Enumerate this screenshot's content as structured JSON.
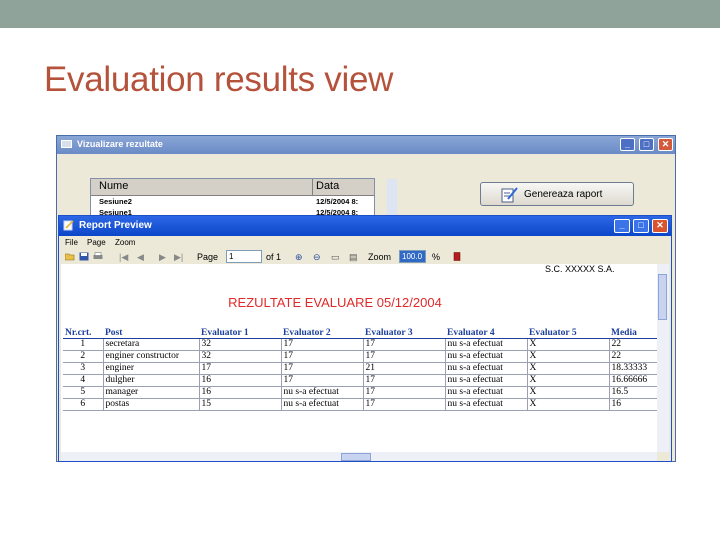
{
  "slide": {
    "title": "Evaluation results view"
  },
  "outer_window": {
    "title": "Vizualizare rezultate",
    "controls": {
      "minimize": "_",
      "maximize": "□",
      "close": "✕"
    }
  },
  "sessions": {
    "headers": [
      "Nume",
      "Data"
    ],
    "rows": [
      [
        "Sesiune2",
        "12/5/2004 8:"
      ],
      [
        "Sesiune1",
        "12/5/2004 8:"
      ]
    ]
  },
  "generate_button": {
    "label": "Genereaza raport",
    "icon": "report-pencil-icon"
  },
  "report_window": {
    "title": "Report Preview",
    "controls": {
      "minimize": "_",
      "maximize": "□",
      "close": "✕"
    },
    "menu": [
      "File",
      "Page",
      "Zoom"
    ],
    "toolbar": {
      "page_label": "Page",
      "page_value": "1",
      "of_label": "of 1",
      "zoom_label": "Zoom",
      "zoom_value": "100.0",
      "percent": "%"
    }
  },
  "report": {
    "company": "S.C. XXXXX S.A.",
    "heading": "REZULTATE EVALUARE 05/12/2004",
    "columns": [
      "Nr.crt.",
      "Post",
      "Evaluator 1",
      "Evaluator 2",
      "Evaluator 3",
      "Evaluator 4",
      "Evaluator 5",
      "Media"
    ],
    "rows": [
      [
        "1",
        "secretara",
        "32",
        "17",
        "17",
        "nu s-a efectuat",
        "X",
        "22"
      ],
      [
        "2",
        "enginer constructor",
        "32",
        "17",
        "17",
        "nu s-a efectuat",
        "X",
        "22"
      ],
      [
        "3",
        "enginer",
        "17",
        "17",
        "21",
        "nu s-a efectuat",
        "X",
        "18.33333"
      ],
      [
        "4",
        "dulgher",
        "16",
        "17",
        "17",
        "nu s-a efectuat",
        "X",
        "16.66666"
      ],
      [
        "5",
        "manager",
        "16",
        "nu s-a efectuat",
        "17",
        "nu s-a efectuat",
        "X",
        "16.5"
      ],
      [
        "6",
        "postas",
        "15",
        "nu s-a efectuat",
        "17",
        "nu s-a efectuat",
        "X",
        "16"
      ]
    ]
  },
  "colors": {
    "slide_title": "#b5523b",
    "report_heading": "#e02a2a",
    "table_header": "#1c3f9c",
    "title_bar": "#0a47c8"
  }
}
